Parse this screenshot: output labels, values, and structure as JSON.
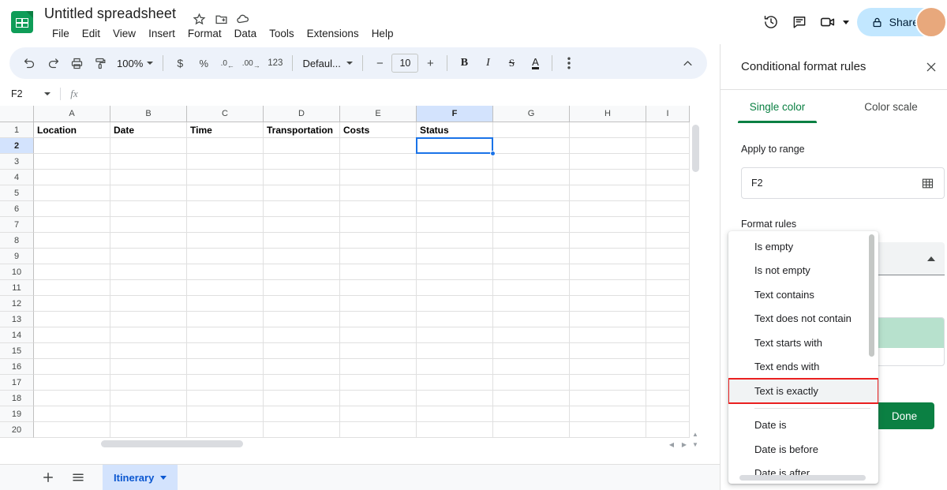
{
  "header": {
    "doc_title": "Untitled spreadsheet",
    "title_icons": [
      "star-icon",
      "move-to-folder-icon",
      "cloud-saved-icon"
    ],
    "menus": [
      "File",
      "Edit",
      "View",
      "Insert",
      "Format",
      "Data",
      "Tools",
      "Extensions",
      "Help"
    ],
    "right_icons": [
      "version-history-icon",
      "comment-icon",
      "video-meet-icon"
    ],
    "share_label": "Share",
    "share_bg": "#c2e7ff"
  },
  "toolbar": {
    "zoom": "100%",
    "currency": "$",
    "percent": "%",
    "decrease_decimal": ".0",
    "increase_decimal": ".00",
    "more_formats": "123",
    "font": "Defaul...",
    "font_size": "10",
    "bold": "B",
    "italic": "I",
    "strikethrough": "S",
    "text_color": "A",
    "minus": "−",
    "plus": "+"
  },
  "formula_bar": {
    "name_box": "F2",
    "fx": "fx",
    "value": ""
  },
  "grid": {
    "columns": [
      "A",
      "B",
      "C",
      "D",
      "E",
      "F",
      "G",
      "H",
      "I"
    ],
    "selected_column": "F",
    "selected_row": "2",
    "rows": [
      "1",
      "2",
      "3",
      "4",
      "5",
      "6",
      "7",
      "8",
      "9",
      "10",
      "11",
      "12",
      "13",
      "14",
      "15",
      "16",
      "17",
      "18",
      "19",
      "20"
    ],
    "header_row": [
      "Location",
      "Date",
      "Time",
      "Transportation",
      "Costs",
      "Status",
      "",
      "",
      ""
    ],
    "active_cell": "F2",
    "selection_color": "#1a73e8"
  },
  "bottom": {
    "add_sheet": "add-sheet-icon",
    "all_sheets": "all-sheets-icon",
    "sheet_name": "Itinerary",
    "explore": "sparkle-icon"
  },
  "panel": {
    "title": "Conditional format rules",
    "close": "close-icon",
    "tabs": [
      {
        "label": "Single color",
        "active": true
      },
      {
        "label": "Color scale",
        "active": false
      }
    ],
    "apply_to_range_label": "Apply to range",
    "range_value": "F2",
    "range_picker_icon": "grid-select-icon",
    "format_rules_label": "Format rules",
    "done_label": "Done",
    "accent_color": "#0b8043",
    "preview_fill": "#b7e1cd"
  },
  "dropdown": {
    "items": [
      {
        "label": "Is empty",
        "divider_after": false,
        "highlight": false
      },
      {
        "label": "Is not empty",
        "divider_after": false,
        "highlight": false
      },
      {
        "label": "Text contains",
        "divider_after": false,
        "highlight": false
      },
      {
        "label": "Text does not contain",
        "divider_after": false,
        "highlight": false
      },
      {
        "label": "Text starts with",
        "divider_after": false,
        "highlight": false
      },
      {
        "label": "Text ends with",
        "divider_after": false,
        "highlight": false
      },
      {
        "label": "Text is exactly",
        "divider_after": true,
        "highlight": true
      },
      {
        "label": "Date is",
        "divider_after": false,
        "highlight": false
      },
      {
        "label": "Date is before",
        "divider_after": false,
        "highlight": false
      },
      {
        "label": "Date is after",
        "divider_after": false,
        "highlight": false
      }
    ],
    "highlight_color": "#ea2020"
  }
}
